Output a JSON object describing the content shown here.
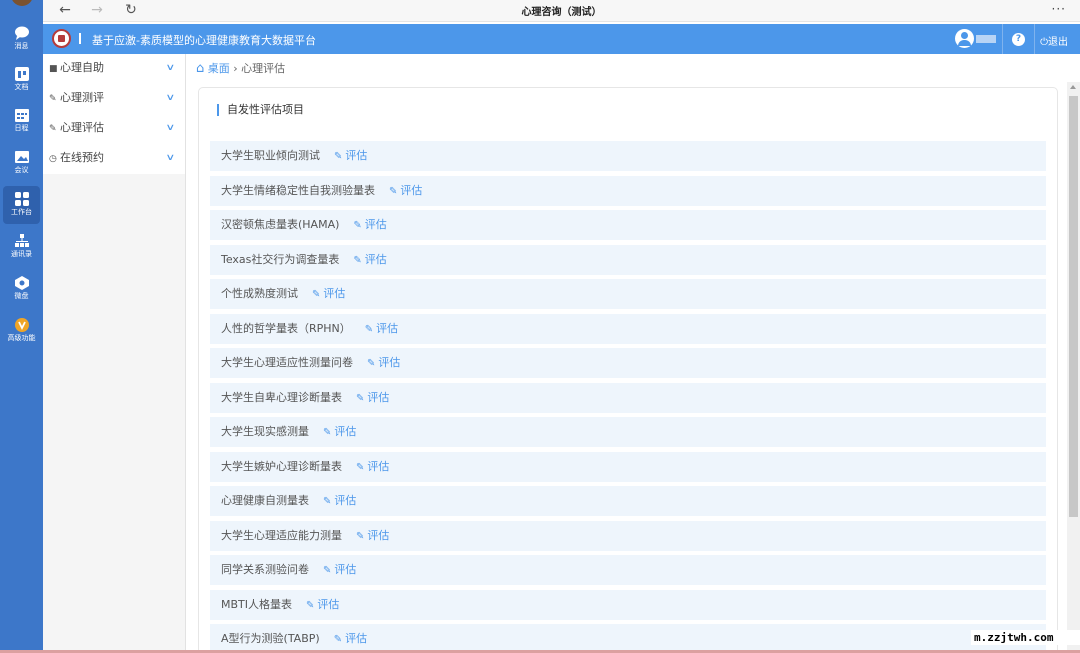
{
  "window": {
    "title": "心理咨询（测试）",
    "more": "···"
  },
  "leftbar": {
    "items": [
      {
        "label": "消息",
        "icon": "chat-bubble-icon"
      },
      {
        "label": "文档",
        "icon": "document-icon"
      },
      {
        "label": "日程",
        "icon": "calendar-icon"
      },
      {
        "label": "会议",
        "icon": "meeting-image-icon"
      },
      {
        "label": "工作台",
        "icon": "grid-apps-icon"
      },
      {
        "label": "通讯录",
        "icon": "org-chart-icon"
      },
      {
        "label": "微盘",
        "icon": "cloud-disk-icon"
      },
      {
        "label": "高级功能",
        "icon": "vip-badge-icon"
      }
    ]
  },
  "header": {
    "title": "基于应激-素质模型的心理健康教育大数据平台",
    "logout": "退出",
    "help": "?"
  },
  "sidebar": {
    "items": [
      {
        "label": "心理自助",
        "icon": "book-icon"
      },
      {
        "label": "心理测评",
        "icon": "edit-icon"
      },
      {
        "label": "心理评估",
        "icon": "edit-icon"
      },
      {
        "label": "在线预约",
        "icon": "clock-icon"
      }
    ]
  },
  "breadcrumb": {
    "home": "桌面",
    "sep": "›",
    "current": "心理评估"
  },
  "panel": {
    "title": "自发性评估项目"
  },
  "eval_label": "评估",
  "items": [
    "大学生职业倾向测试",
    "大学生情绪稳定性自我测验量表",
    "汉密顿焦虑量表(HAMA)",
    "Texas社交行为调查量表",
    "个性成熟度测试",
    "人性的哲学量表（RPHN）",
    "大学生心理适应性测量问卷",
    "大学生自卑心理诊断量表",
    "大学生现实感测量",
    "大学生嫉妒心理诊断量表",
    "心理健康自测量表",
    "大学生心理适应能力测量",
    "同学关系测验问卷",
    "MBTI人格量表",
    "A型行为测验(TABP)"
  ],
  "watermark": "m.zzjtwh.com",
  "colors": {
    "accent": "#4c97ea",
    "leftbar": "#3d77c9",
    "row_bg": "#eef5fc"
  }
}
